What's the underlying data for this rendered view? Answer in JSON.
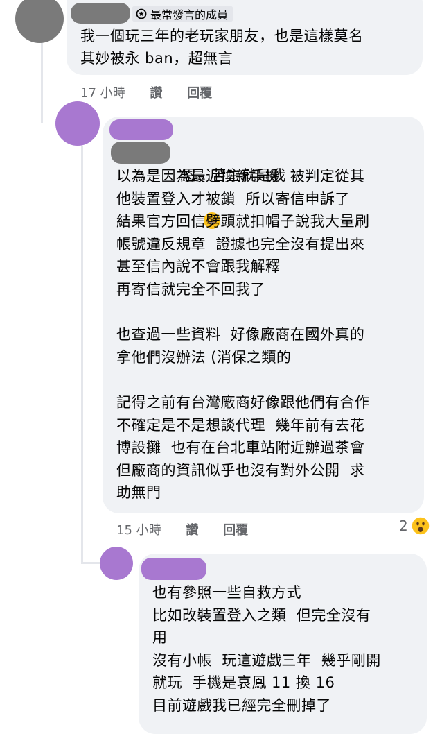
{
  "comments": [
    {
      "badge": "最常發言的成員",
      "lines": [
        "我一個玩三年的老玩家朋友，也是這樣莫名",
        "其妙被永 ban，超無言"
      ],
      "time": "17 小時",
      "like": "讚",
      "reply": "回覆"
    },
    {
      "first_line": "恩…苦主就是我",
      "lines": [
        "以為是因為最近換新手機  被判定從其",
        "他裝置登入才被鎖  所以寄信申訴了",
        "結果官方回信劈頭就扣帽子說我大量刷",
        "帳號違反規章  證據也完全沒有提出來",
        "甚至信內說不會跟我解釋",
        "再寄信就完全不回我了",
        "",
        "也查過一些資料  好像廠商在國外真的",
        "拿他們沒辦法 (消保之類的",
        "",
        "記得之前有台灣廠商好像跟他們有合作",
        "不確定是不是想談代理  幾年前有去花",
        "博設攤  也有在台北車站附近辦過茶會",
        "但廠商的資訊似乎也沒有對外公開  求",
        "助無門"
      ],
      "time": "15 小時",
      "like": "讚",
      "reply": "回覆",
      "reaction_count": "2"
    },
    {
      "lines": [
        "也有參照一些自救方式",
        "比如改裝置登入之類  但完全沒有",
        "用",
        "沒有小帳  玩這遊戲三年  幾乎剛開",
        "就玩  手機是哀鳳 11 換 16",
        "目前遊戲我已經完全刪掉了"
      ]
    }
  ],
  "colors": {
    "bubble": "#f0f2f5",
    "meta": "#65676b",
    "avatar_purple": "#a878d0",
    "redact_gray": "#7a7a7a",
    "redact_purple": "#a878d0"
  },
  "icons": [
    "badge-icon",
    "grin-sweat-emoji",
    "wow-reaction-icon"
  ]
}
